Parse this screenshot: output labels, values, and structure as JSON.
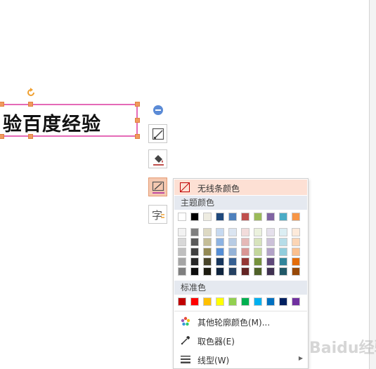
{
  "textbox": {
    "text": "验百度经验"
  },
  "panel": {
    "no_line_label": "无线条颜色",
    "theme_colors_label": "主题颜色",
    "standard_colors_label": "标准色",
    "more_colors_label": "其他轮廓颜色(M)...",
    "eyedropper_label": "取色器(E)",
    "line_style_label": "线型(W)",
    "theme_row": [
      "#ffffff",
      "#000000",
      "#eeece1",
      "#1f497d",
      "#4f81bd",
      "#c0504d",
      "#9bbb59",
      "#8064a2",
      "#4bacc6",
      "#f79646"
    ],
    "theme_shades": [
      [
        "#f2f2f2",
        "#7f7f7f",
        "#ddd9c3",
        "#c6d9f0",
        "#dbe5f1",
        "#f2dcdb",
        "#ebf1dd",
        "#e5e0ec",
        "#dbeef3",
        "#fdeada"
      ],
      [
        "#d8d8d8",
        "#595959",
        "#c4bd97",
        "#8db3e2",
        "#b8cce4",
        "#e5b9b7",
        "#d7e3bc",
        "#ccc1d9",
        "#b7dde8",
        "#fbd5b5"
      ],
      [
        "#bfbfbf",
        "#3f3f3f",
        "#938953",
        "#548dd4",
        "#95b3d7",
        "#d99694",
        "#c3d69b",
        "#b2a2c7",
        "#92cddc",
        "#fac08f"
      ],
      [
        "#a5a5a5",
        "#262626",
        "#494429",
        "#17365d",
        "#366092",
        "#953734",
        "#76923c",
        "#5f497a",
        "#31859b",
        "#e36c09"
      ],
      [
        "#7f7f7f",
        "#0c0c0c",
        "#1d1b10",
        "#0f243e",
        "#244061",
        "#632423",
        "#4f6128",
        "#3f3151",
        "#205867",
        "#974806"
      ]
    ],
    "standard_row": [
      "#c00000",
      "#ff0000",
      "#ffc000",
      "#ffff00",
      "#92d050",
      "#00b050",
      "#00b0f0",
      "#0070c0",
      "#002060",
      "#7030a0"
    ]
  },
  "watermark": "Baidu经验"
}
